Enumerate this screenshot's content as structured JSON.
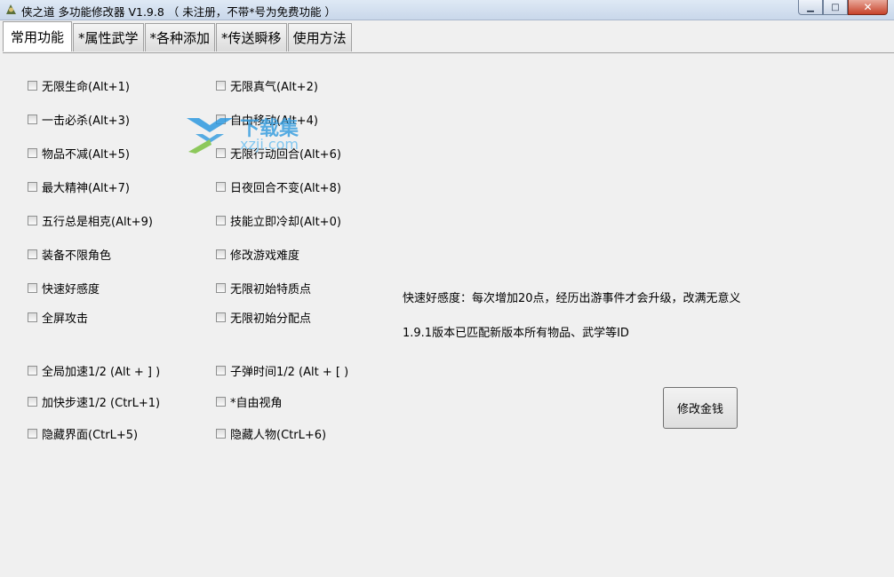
{
  "window": {
    "title": "侠之道 多功能修改器 V1.9.8 （ 未注册，不带*号为免费功能 ）",
    "buttons": {
      "minimize": "▁",
      "maximize": "□",
      "close": "✕"
    }
  },
  "tabs": [
    "常用功能",
    "*属性武学",
    "*各种添加",
    "*传送瞬移",
    "使用方法"
  ],
  "checkboxes": {
    "left": [
      "无限生命(Alt+1)",
      "一击必杀(Alt+3)",
      "物品不减(Alt+5)",
      "最大精神(Alt+7)",
      "五行总是相克(Alt+9)",
      "装备不限角色",
      "快速好感度",
      "全屏攻击",
      "全局加速1/2 (Alt + ] )",
      "加快步速1/2 (CtrL+1)",
      "隐藏界面(CtrL+5)"
    ],
    "right": [
      "无限真气(Alt+2)",
      "自由移动(Alt+4)",
      "无限行动回合(Alt+6)",
      "日夜回合不变(Alt+8)",
      "技能立即冷却(Alt+0)",
      "修改游戏难度",
      "无限初始特质点",
      "无限初始分配点",
      "子弹时间1/2 (Alt + [ )",
      "*自由视角",
      "隐藏人物(CtrL+6)"
    ]
  },
  "notes": [
    "快速好感度：每次增加20点，经历出游事件才会升级，改满无意义",
    "1.9.1版本已匹配新版本所有物品、武学等ID"
  ],
  "money_button": "修改金钱",
  "watermark": {
    "brand": "下载集",
    "site": "xzji.com"
  }
}
